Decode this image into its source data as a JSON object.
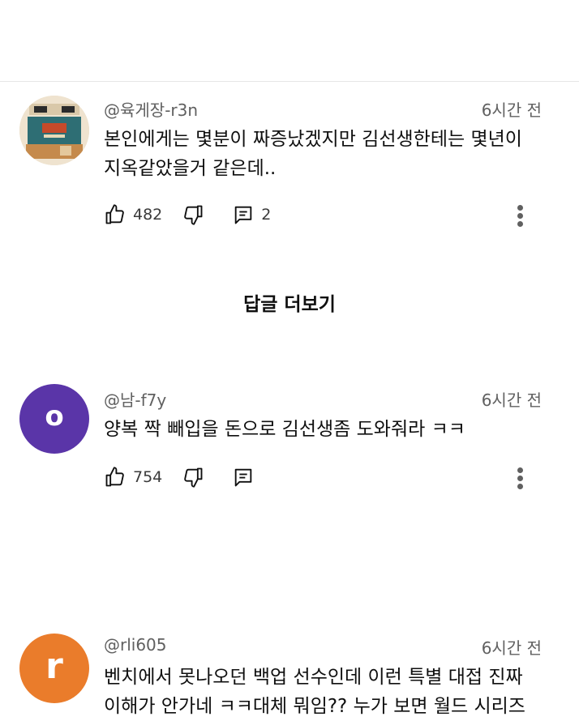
{
  "comments": [
    {
      "handle": "@육게장-r3n",
      "time": "6시간 전",
      "text_line1": "본인에게는 몇분이 짜증났겠지만 김선생한테는 몇년이",
      "text_line2": "지옥같았을거 같은데..",
      "likes": "482",
      "replies": "2",
      "avatar_kind": "image-thumbnail"
    },
    {
      "handle": "@남-f7y",
      "time": "6시간 전",
      "text_line1": "양복 짝 빼입을 돈으로 김선생좀 도와줘라 ㅋㅋ",
      "likes": "754",
      "avatar_letter": "o",
      "avatar_color": "#5a35a8"
    },
    {
      "handle": "@rli605",
      "time": "6시간 전",
      "text_line1": "벤치에서 못나오던 백업 선수인데 이런 특별 대접 진짜",
      "text_line2": "이해가 안가네 ㅋㅋ대체 뭐임?? 누가 보면 월드 시리즈",
      "avatar_letter": "r",
      "avatar_color": "#ea7c2b"
    }
  ],
  "replies_link": "답글 더보기",
  "icons": {
    "like": "thumbs-up-icon",
    "dislike": "thumbs-down-icon",
    "reply": "comment-icon",
    "more": "more-vertical-icon"
  }
}
